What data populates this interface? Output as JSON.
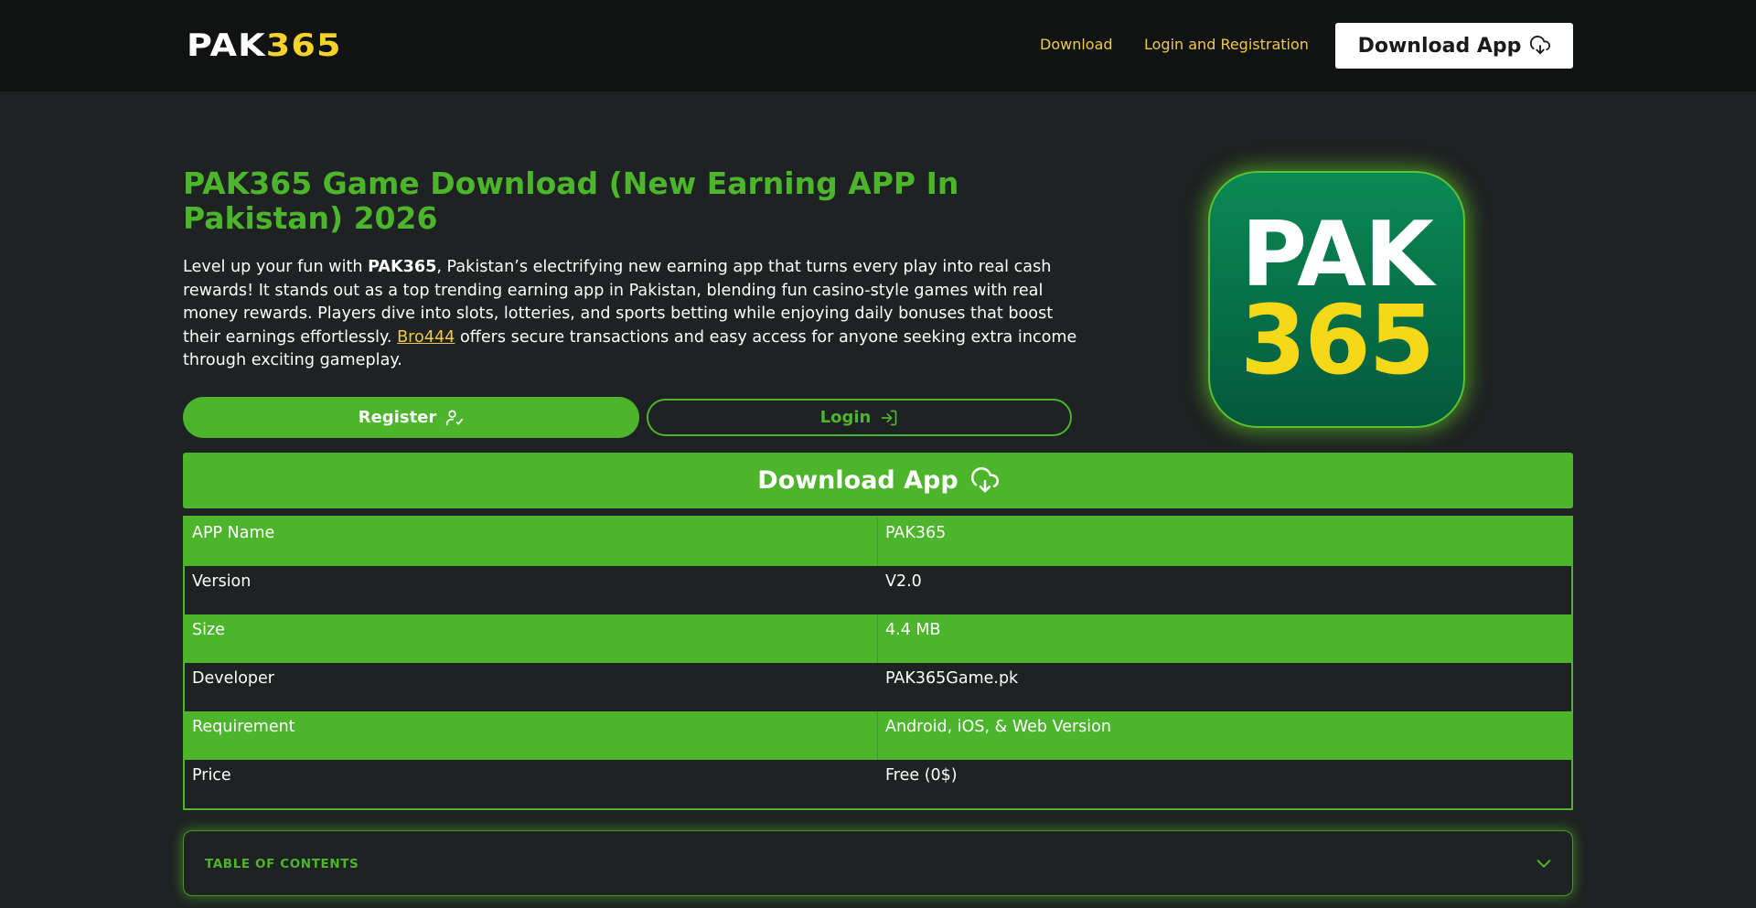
{
  "header": {
    "logo_part1": "PAK",
    "logo_part2": "365",
    "nav": [
      {
        "label": "Download"
      },
      {
        "label": "Login and Registration"
      }
    ],
    "download_button": "Download App"
  },
  "hero": {
    "title": "PAK365 Game Download (New Earning APP In Pakistan) 2026",
    "intro_before_bold": "Level up your fun with ",
    "intro_bold": "PAK365",
    "intro_after_bold": ", Pakistan’s electrifying new earning app that turns every play into real cash rewards! It stands out as a top trending earning app in Pakistan, blending fun casino-style games with real money rewards. Players dive into slots, lotteries, and sports betting while enjoying daily bonuses that boost their earnings effortlessly. ",
    "intro_link": "Bro444",
    "intro_after_link": " offers secure transactions and easy access for anyone seeking extra income through exciting gameplay.",
    "register_label": "Register",
    "login_label": "Login",
    "app_icon_line1": "PAK",
    "app_icon_line2": "365"
  },
  "download_app_label": "Download App",
  "app_info": [
    {
      "key": "APP Name",
      "value": "PAK365"
    },
    {
      "key": "Version",
      "value": "V2.0"
    },
    {
      "key": "Size",
      "value": "4.4 MB"
    },
    {
      "key": "Developer",
      "value": "PAK365Game.pk"
    },
    {
      "key": "Requirement",
      "value": "Android, iOS, & Web Version"
    },
    {
      "key": "Price",
      "value": "Free (0$)"
    }
  ],
  "toc": {
    "label": "TABLE OF CONTENTS"
  },
  "colors": {
    "accent_green": "#4cb52c",
    "link_yellow": "#f0c94a",
    "background": "#1e2222",
    "header_bg": "#111313"
  },
  "icons": {
    "download": "cloud-download-icon",
    "register": "user-check-icon",
    "login": "log-in-icon",
    "toc_toggle": "chevron-down-icon"
  }
}
